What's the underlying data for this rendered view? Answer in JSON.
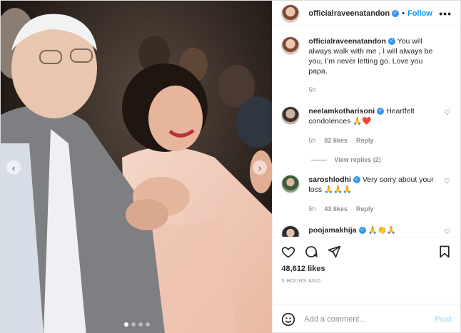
{
  "post": {
    "username": "officialraveenatandon",
    "follow_label": "Follow",
    "separator": "•",
    "more_label": "•••"
  },
  "caption": {
    "username": "officialraveenatandon",
    "text": "You will always walk with me , I will always be you, I’m never letting go. Love you papa.",
    "time": "5h"
  },
  "comments": [
    {
      "username": "neelamkotharisoni",
      "text": "Heartfelt condolences 🙏❤️",
      "time": "5h",
      "likes": "82 likes",
      "reply_label": "Reply"
    },
    {
      "username": "saroshlodhi",
      "text": "Very sorry about your loss 🙏🙏🙏",
      "time": "5h",
      "likes": "43 likes",
      "reply_label": "Reply"
    },
    {
      "username": "poojamakhija",
      "text": "🙏👏🙏"
    }
  ],
  "view_replies": "View replies (2)",
  "likes_count": "48,612 likes",
  "timestamp": "5 HOURS AGO",
  "add_comment": {
    "placeholder": "Add a comment...",
    "post_label": "Post"
  },
  "carousel": {
    "slides": 4,
    "active_index": 0,
    "prev_glyph": "‹",
    "next_glyph": "›"
  },
  "colors": {
    "accent": "#0095f6",
    "post_disabled": "#b2dffc",
    "muted": "#8e8e8e",
    "verified": "#3897f0"
  }
}
